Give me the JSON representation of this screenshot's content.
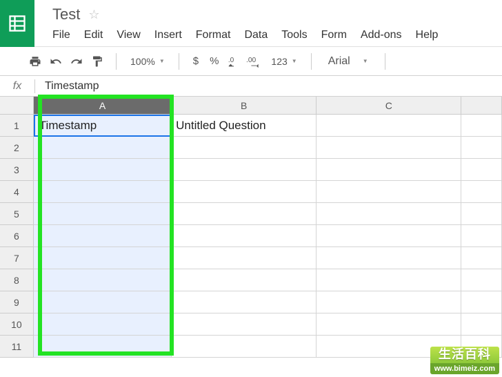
{
  "doc": {
    "title": "Test"
  },
  "menu": {
    "file": "File",
    "edit": "Edit",
    "view": "View",
    "insert": "Insert",
    "format": "Format",
    "data": "Data",
    "tools": "Tools",
    "form": "Form",
    "addons": "Add-ons",
    "help": "Help"
  },
  "toolbar": {
    "zoom": "100%",
    "currency": "$",
    "percent": "%",
    "dec_dec": ".0",
    "dec_inc": ".00",
    "numfmt": "123",
    "font": "Arial"
  },
  "formula": {
    "label": "fx",
    "value": "Timestamp"
  },
  "cols": {
    "a": "A",
    "b": "B",
    "c": "C"
  },
  "rows": [
    "1",
    "2",
    "3",
    "4",
    "5",
    "6",
    "7",
    "8",
    "9",
    "10",
    "11"
  ],
  "cells": {
    "a1": "Timestamp",
    "b1": "Untitled Question"
  },
  "watermark": {
    "top": "生活百科",
    "bot": "www.bimeiz.com"
  }
}
